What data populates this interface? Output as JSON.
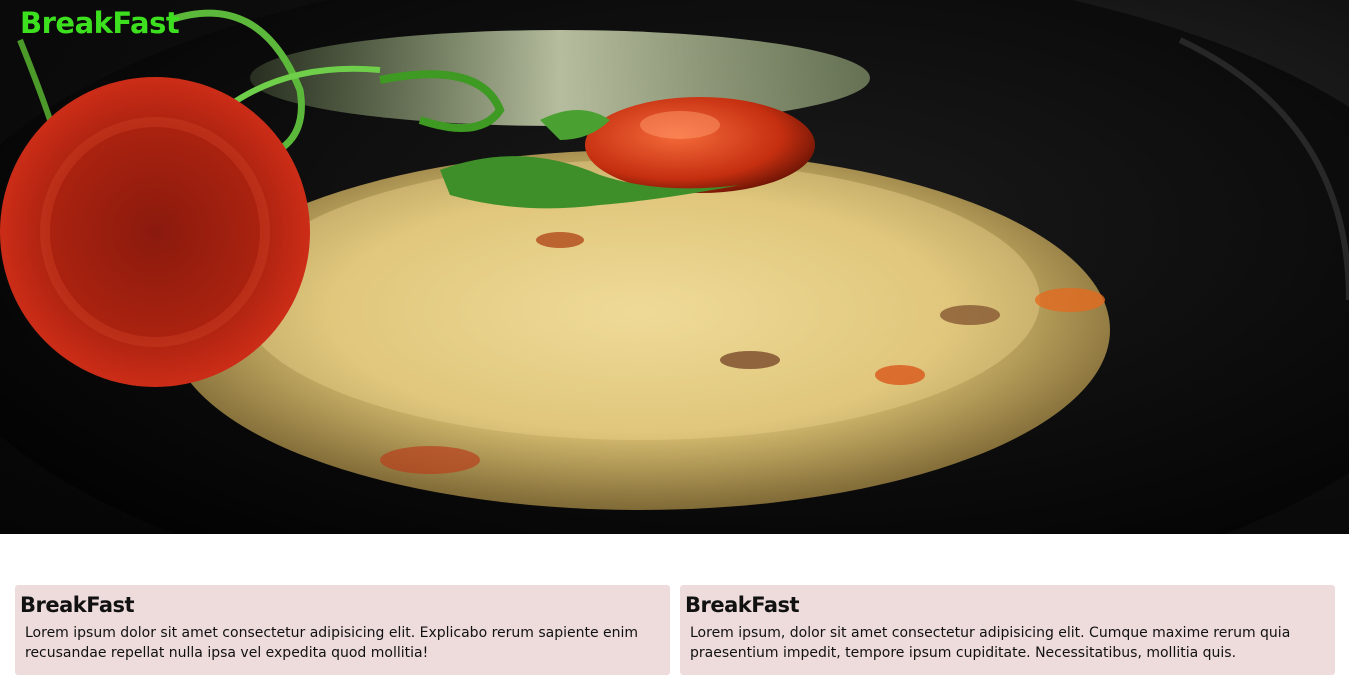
{
  "header": {
    "brand": "BreakFast"
  },
  "hero": {
    "image": "fried-rice-plate-photo"
  },
  "cards": [
    {
      "title": "BreakFast",
      "text": "Lorem ipsum dolor sit amet consectetur adipisicing elit. Explicabo rerum sapiente enim recusandae repellat nulla ipsa vel expedita quod mollitia!"
    },
    {
      "title": "BreakFast",
      "text": "Lorem ipsum, dolor sit amet consectetur adipisicing elit. Cumque maxime rerum quia praesentium impedit, tempore ipsum cupiditate. Necessitatibus, mollitia quis."
    }
  ],
  "colors": {
    "brand": "#3de01f",
    "card_bg": "#eedcdc"
  }
}
